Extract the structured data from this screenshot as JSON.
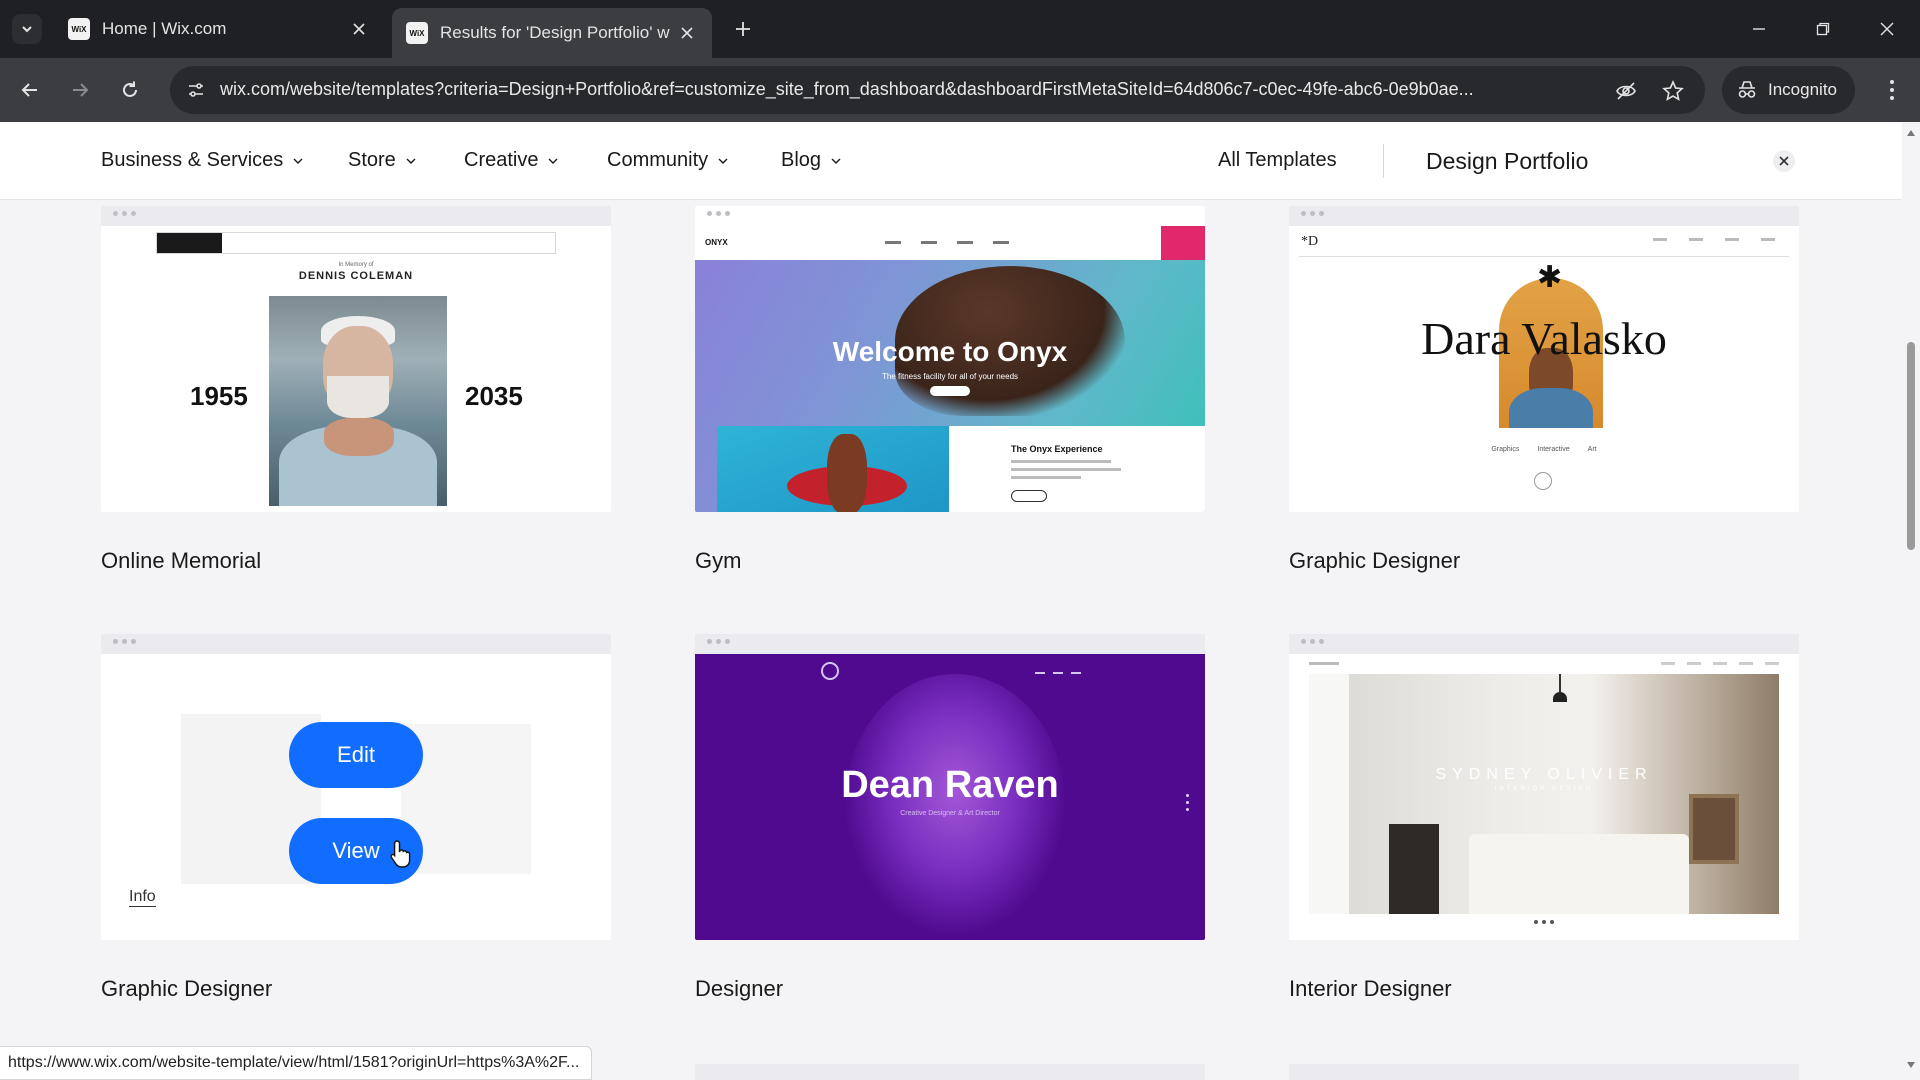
{
  "browser": {
    "tabs": [
      {
        "favicon": "WiX",
        "title": "Home | Wix.com",
        "active": false
      },
      {
        "favicon": "WiX",
        "title": "Results for 'Design Portfolio' w",
        "active": true
      }
    ],
    "url": "wix.com/website/templates?criteria=Design+Portfolio&ref=customize_site_from_dashboard&dashboardFirstMetaSiteId=64d806c7-c0ec-49fe-abc6-0e9b0ae...",
    "incognito_label": "Incognito",
    "status_url": "https://www.wix.com/website-template/view/html/1581?originUrl=https%3A%2F..."
  },
  "subnav": {
    "categories": [
      "Business & Services",
      "Store",
      "Creative",
      "Community",
      "Blog"
    ],
    "all_templates": "All Templates",
    "search_value": "Design Portfolio"
  },
  "templates": [
    {
      "title": "Online Memorial",
      "preview": {
        "subtitle": "In Memory of",
        "name": "DENNIS COLEMAN",
        "year_start": "1955",
        "year_end": "2035"
      }
    },
    {
      "title": "Gym",
      "preview": {
        "logo": "ONYX",
        "headline": "Welcome to Onyx",
        "tagline": "The fitness facility for all of your needs",
        "section": "The Onyx Experience"
      }
    },
    {
      "title": "Graphic Designer",
      "preview": {
        "mark": "*D",
        "name": "Dara Valasko",
        "links": [
          "Graphics",
          "Interactive",
          "Art"
        ]
      }
    },
    {
      "title": "Graphic Designer",
      "hover": {
        "edit_label": "Edit",
        "view_label": "View",
        "info_label": "Info"
      }
    },
    {
      "title": "Designer",
      "preview": {
        "name": "Dean Raven",
        "subtitle": "Creative Designer & Art Director"
      }
    },
    {
      "title": "Interior Designer",
      "preview": {
        "name": "SYDNEY OLIVIER",
        "subtitle": "INTERIOR DESIGN"
      }
    }
  ],
  "colors": {
    "accent": "#116dff",
    "gym_pink": "#e0286b",
    "designer_purple": "#4f0a8f"
  }
}
